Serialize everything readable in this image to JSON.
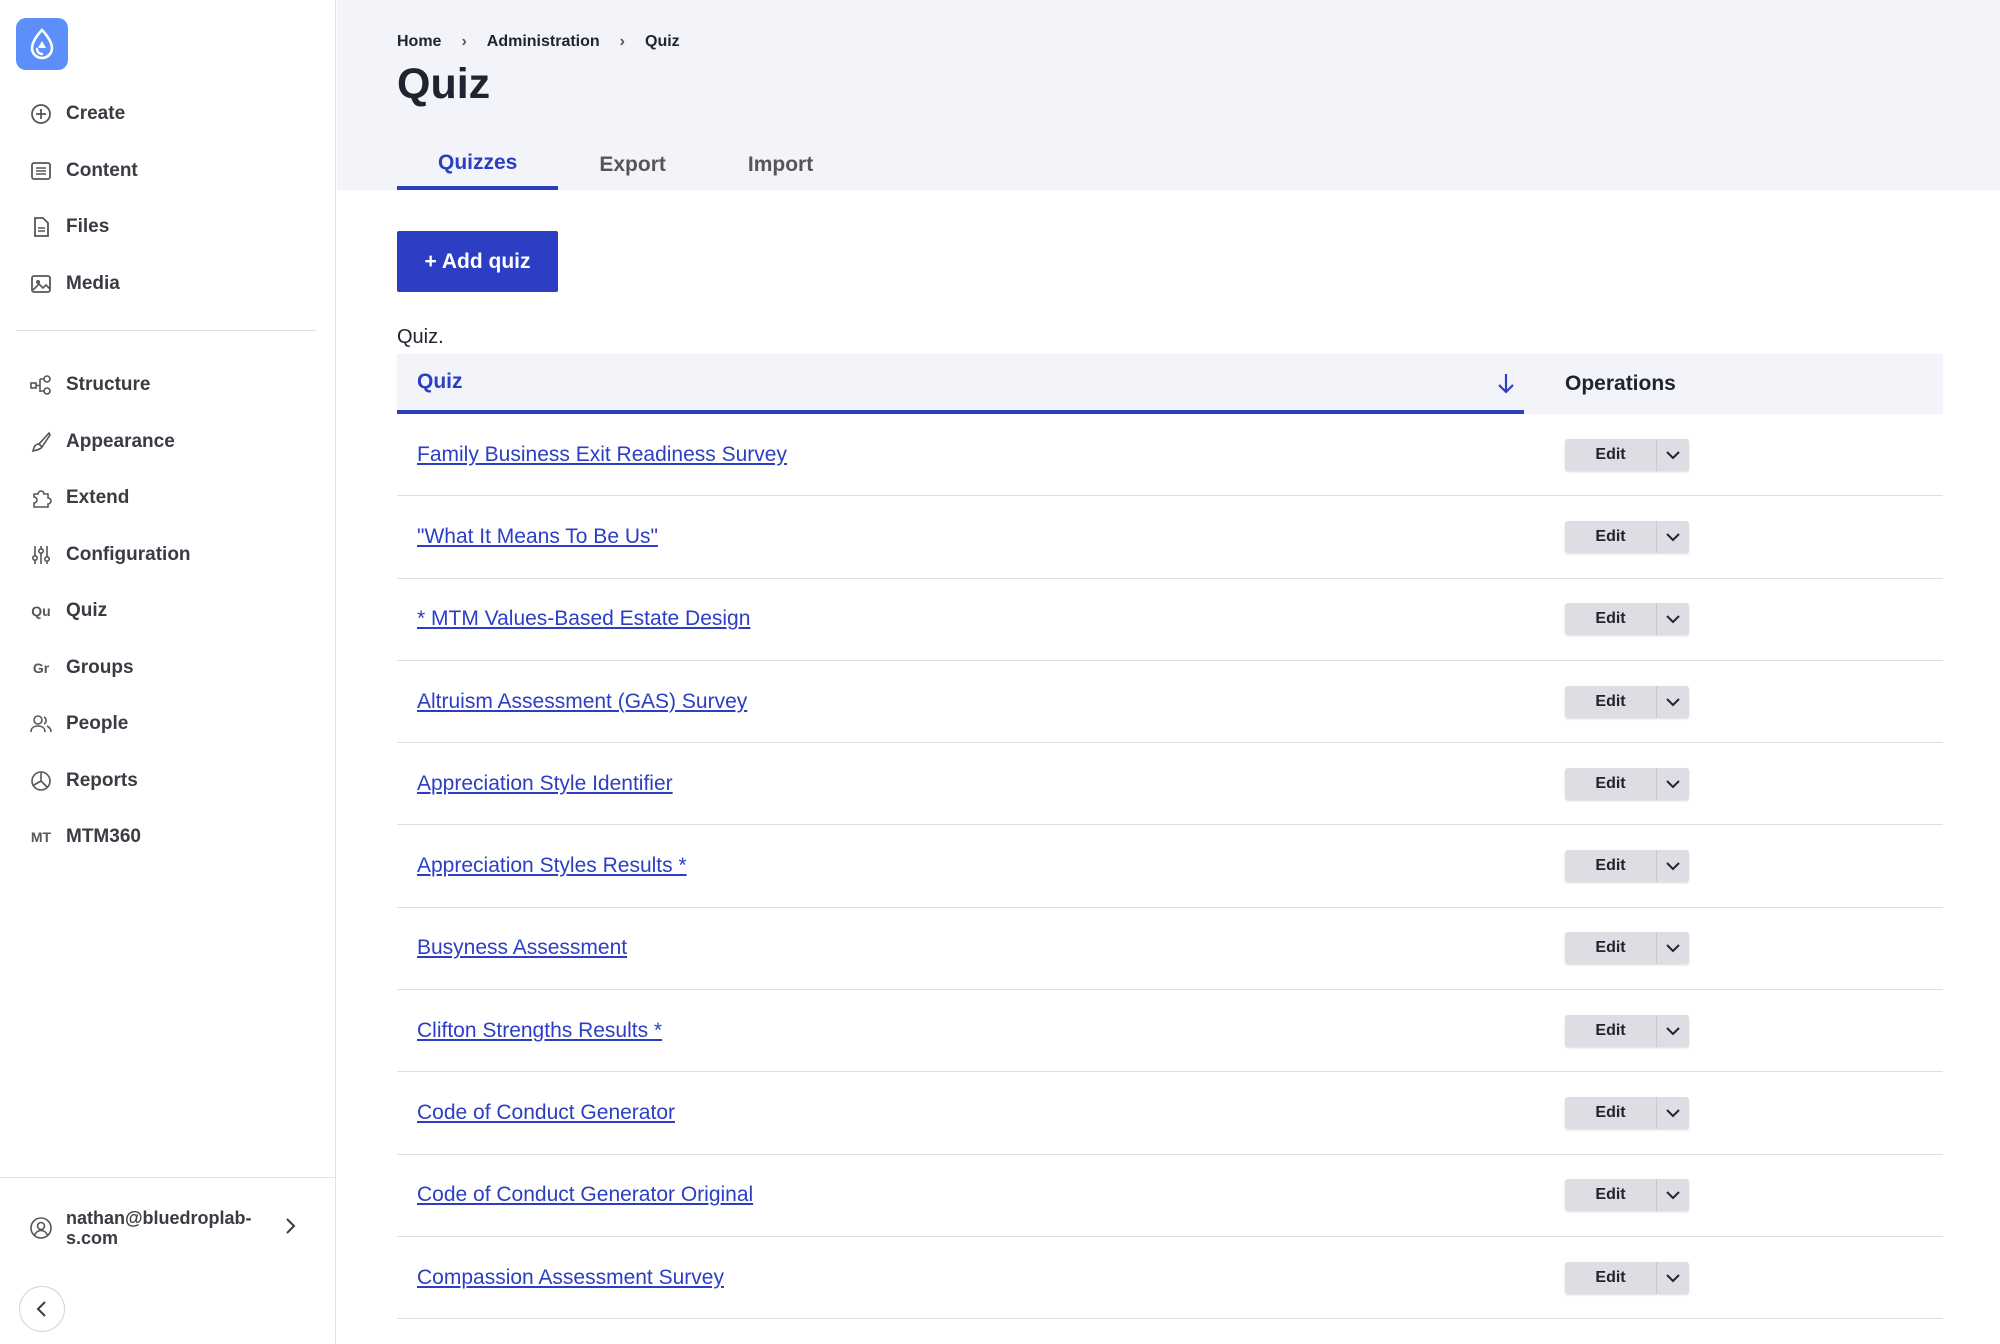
{
  "sidebar": {
    "items": [
      {
        "label": "Create",
        "icon": "plus-circle-icon"
      },
      {
        "label": "Content",
        "icon": "content-icon"
      },
      {
        "label": "Files",
        "icon": "file-icon"
      },
      {
        "label": "Media",
        "icon": "image-icon"
      },
      {
        "label": "Structure",
        "icon": "structure-icon"
      },
      {
        "label": "Appearance",
        "icon": "brush-icon"
      },
      {
        "label": "Extend",
        "icon": "puzzle-icon"
      },
      {
        "label": "Configuration",
        "icon": "sliders-icon"
      },
      {
        "label": "Quiz",
        "icon_text": "Qu"
      },
      {
        "label": "Groups",
        "icon_text": "Gr"
      },
      {
        "label": "People",
        "icon": "people-icon"
      },
      {
        "label": "Reports",
        "icon": "chart-pie-icon"
      },
      {
        "label": "MTM360",
        "icon_text": "MT"
      }
    ],
    "user_email": "nathan@bluedroplab-s.com"
  },
  "breadcrumb": {
    "home": "Home",
    "administration": "Administration",
    "current": "Quiz"
  },
  "page": {
    "title": "Quiz"
  },
  "tabs": {
    "quizzes": "Quizzes",
    "export": "Export",
    "import": "Import"
  },
  "actions": {
    "add_quiz": "+ Add quiz"
  },
  "table": {
    "caption": "Quiz.",
    "col_quiz": "Quiz",
    "col_operations": "Operations",
    "edit_label": "Edit",
    "rows": [
      "Family Business Exit Readiness Survey",
      "\"What It Means To Be Us\"",
      "* MTM Values-Based Estate Design",
      "Altruism Assessment (GAS) Survey",
      "Appreciation Style Identifier",
      "Appreciation Styles Results *",
      "Busyness Assessment",
      "Clifton Strengths Results *",
      "Code of Conduct Generator",
      "Code of Conduct Generator Original",
      "Compassion Assessment Survey"
    ]
  },
  "colors": {
    "accent": "#2b3ec4",
    "logo": "#5c8ffa",
    "header_bg": "#f3f4f9"
  }
}
